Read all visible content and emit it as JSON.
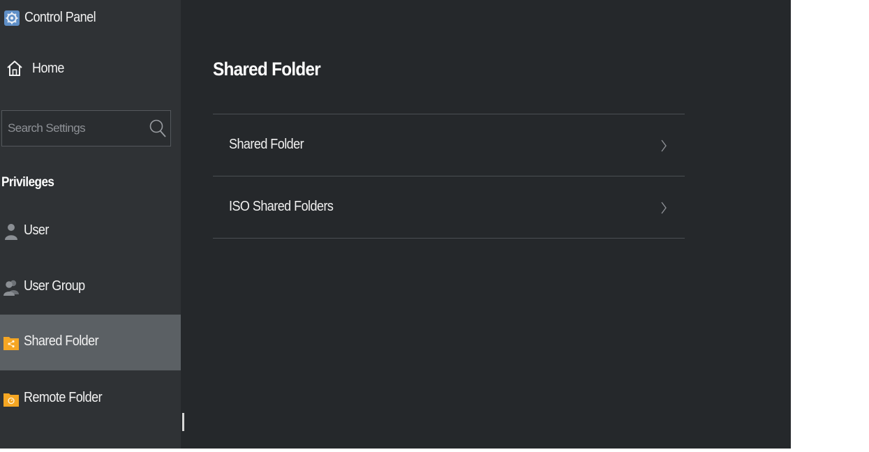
{
  "app": {
    "title": "Control Panel",
    "icon": "gear-icon"
  },
  "sidebar": {
    "home": {
      "label": "Home",
      "icon": "home-icon"
    },
    "search": {
      "placeholder": "Search Settings",
      "value": ""
    },
    "section_heading": "Privileges",
    "items": [
      {
        "label": "User",
        "icon": "user-icon",
        "active": false
      },
      {
        "label": "User Group",
        "icon": "user-group-icon",
        "active": false
      },
      {
        "label": "Shared Folder",
        "icon": "shared-folder-icon",
        "active": true
      },
      {
        "label": "Remote Folder",
        "icon": "remote-folder-icon",
        "active": false
      }
    ]
  },
  "main": {
    "title": "Shared Folder",
    "list": [
      {
        "label": "Shared Folder",
        "icon": "chevron-right-icon"
      },
      {
        "label": "ISO Shared Folders",
        "icon": "chevron-right-icon"
      }
    ]
  },
  "colors": {
    "sidebar_bg": "#2f3235",
    "main_bg": "#25282b",
    "active_item_bg": "#5b6064",
    "folder_orange": "#f5a623"
  }
}
